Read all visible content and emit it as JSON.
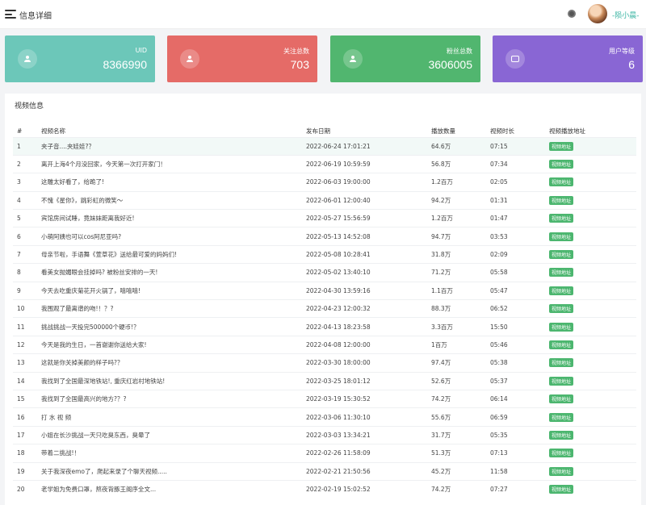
{
  "header": {
    "title": "信息详细",
    "username": "-陨小晨-"
  },
  "stats": [
    {
      "label": "UID",
      "value": "8366990",
      "color": "#6cc7b9"
    },
    {
      "label": "关注总数",
      "value": "703",
      "color": "#e56b67"
    },
    {
      "label": "粉丝总数",
      "value": "3606005",
      "color": "#51b66f"
    },
    {
      "label": "用户等级",
      "value": "6",
      "color": "#8966d4"
    }
  ],
  "videos": {
    "title": "视频信息",
    "columns": [
      "#",
      "视频名称",
      "发布日期",
      "播放数量",
      "视频时长",
      "视频播放地址"
    ],
    "link_label": "视频地址",
    "rows": [
      {
        "no": "1",
        "name": "夹子音....夹娃娃?？",
        "date": "2022-06-24 17:01:21",
        "plays": "64.6万",
        "duration": "07:15"
      },
      {
        "no": "2",
        "name": "离开上海4个月没回家，今天第一次打开家门！",
        "date": "2022-06-19 10:59:59",
        "plays": "56.8万",
        "duration": "07:34"
      },
      {
        "no": "3",
        "name": "这雕太好看了，给跪了!",
        "date": "2022-06-03 19:00:00",
        "plays": "1.2百万",
        "duration": "02:05"
      },
      {
        "no": "4",
        "name": "不愧《星你》，跳彩虹的微笑～",
        "date": "2022-06-01 12:00:40",
        "plays": "94.2万",
        "duration": "01:31"
      },
      {
        "no": "5",
        "name": "宾馆房间试睡，竟妹妹距离我好近!",
        "date": "2022-05-27 15:56:59",
        "plays": "1.2百万",
        "duration": "01:47"
      },
      {
        "no": "6",
        "name": "小萌阿姨也可以cos阿尼亚吗?",
        "date": "2022-05-13 14:52:08",
        "plays": "94.7万",
        "duration": "03:53"
      },
      {
        "no": "7",
        "name": "母亲节啦，手语舞《萱草花》送给最可爱的妈妈们!",
        "date": "2022-05-08 10:28:41",
        "plays": "31.8万",
        "duration": "02:09"
      },
      {
        "no": "8",
        "name": "看美女抛媚眼会挂掉吗? 被粉丝安排的一天!",
        "date": "2022-05-02 13:40:10",
        "plays": "71.2万",
        "duration": "05:58"
      },
      {
        "no": "9",
        "name": "今天去吃重庆菊花开火锅了，嘻嘻嘻!",
        "date": "2022-04-30 13:59:16",
        "plays": "1.1百万",
        "duration": "05:47"
      },
      {
        "no": "10",
        "name": "我围观了最离谱的吻!！？?",
        "date": "2022-04-23 12:00:32",
        "plays": "88.3万",
        "duration": "06:52"
      },
      {
        "no": "11",
        "name": "挑战挑战一天投完500000个硬币!？",
        "date": "2022-04-13 18:23:58",
        "plays": "3.3百万",
        "duration": "15:50"
      },
      {
        "no": "12",
        "name": "今天是我的生日，一首谢谢你送给大家!",
        "date": "2022-04-08 12:00:00",
        "plays": "1百万",
        "duration": "05:46"
      },
      {
        "no": "13",
        "name": "这就是你关掉美颜的样子吗?？",
        "date": "2022-03-30 18:00:00",
        "plays": "97.4万",
        "duration": "05:38"
      },
      {
        "no": "14",
        "name": "我找到了全国最深地铁站!, 重庆红岩村地铁站!",
        "date": "2022-03-25 18:01:12",
        "plays": "52.6万",
        "duration": "05:37"
      },
      {
        "no": "15",
        "name": "我找到了全国最高兴的地方?？?",
        "date": "2022-03-19 15:30:52",
        "plays": "74.2万",
        "duration": "06:14"
      },
      {
        "no": "16",
        "name": "打 水 视 频",
        "date": "2022-03-06 11:30:10",
        "plays": "55.6万",
        "duration": "06:59"
      },
      {
        "no": "17",
        "name": "小姐在长沙挑战一天只吃臭东西，臭晕了",
        "date": "2022-03-03 13:34:21",
        "plays": "31.7万",
        "duration": "05:35"
      },
      {
        "no": "18",
        "name": "带着二挑战!！",
        "date": "2022-02-26 11:58:09",
        "plays": "51.3万",
        "duration": "07:13"
      },
      {
        "no": "19",
        "name": "关于我深夜emo了，爬起来录了个聊天视频.....",
        "date": "2022-02-21 21:50:56",
        "plays": "45.2万",
        "duration": "11:58"
      },
      {
        "no": "20",
        "name": "老学姐为免费口罩，熬夜背豚王阁序全文...",
        "date": "2022-02-19 15:02:52",
        "plays": "74.2万",
        "duration": "07:27"
      }
    ]
  }
}
